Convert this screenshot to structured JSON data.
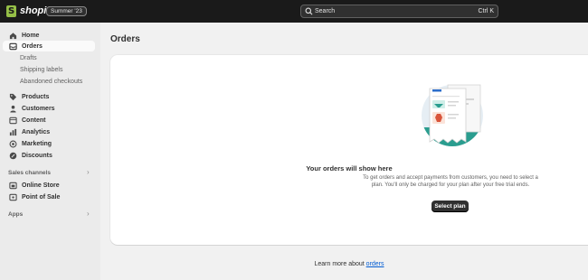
{
  "topbar": {
    "brand": "shopify",
    "badge": "Summer '23",
    "search_placeholder": "Search",
    "search_shortcut": "Ctrl K"
  },
  "sidebar": {
    "home": "Home",
    "orders": "Orders",
    "orders_sub": [
      "Drafts",
      "Shipping labels",
      "Abandoned checkouts"
    ],
    "products": "Products",
    "customers": "Customers",
    "content": "Content",
    "analytics": "Analytics",
    "marketing": "Marketing",
    "discounts": "Discounts",
    "sales_channels_heading": "Sales channels",
    "online_store": "Online Store",
    "point_of_sale": "Point of Sale",
    "apps_heading": "Apps"
  },
  "main": {
    "title": "Orders",
    "empty_title": "Your orders will show here",
    "empty_desc": "To get orders and accept payments from customers, you need to select a plan. You'll only be charged for your plan after your free trial ends.",
    "cta": "Select plan",
    "footer_prefix": "Learn more about ",
    "footer_link": "orders"
  },
  "colors": {
    "topbar": "#1a1a1a",
    "accent_green": "#95bf47",
    "illustration_teal": "#2a9d8f",
    "link": "#005bd3"
  }
}
